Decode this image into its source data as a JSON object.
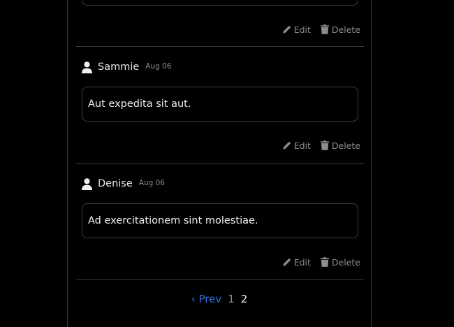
{
  "actions": {
    "edit_label": "Edit",
    "delete_label": "Delete"
  },
  "comments": [
    {
      "author": "Sammie",
      "date": "Aug 06",
      "text": "Aut expedita sit aut."
    },
    {
      "author": "Denise",
      "date": "Aug 06",
      "text": "Ad exercitationem sint molestiae."
    }
  ],
  "pagination": {
    "prev_label": "‹ Prev",
    "pages": [
      "1",
      "2"
    ],
    "current_page": "2"
  },
  "colors": {
    "background": "#000000",
    "border": "#3a3a3a",
    "text": "#f0f0f0",
    "muted": "#8c8c8c",
    "link": "#2f6fd8"
  },
  "icons": {
    "user": "user-icon",
    "edit": "pencil-icon",
    "delete": "trash-icon"
  }
}
